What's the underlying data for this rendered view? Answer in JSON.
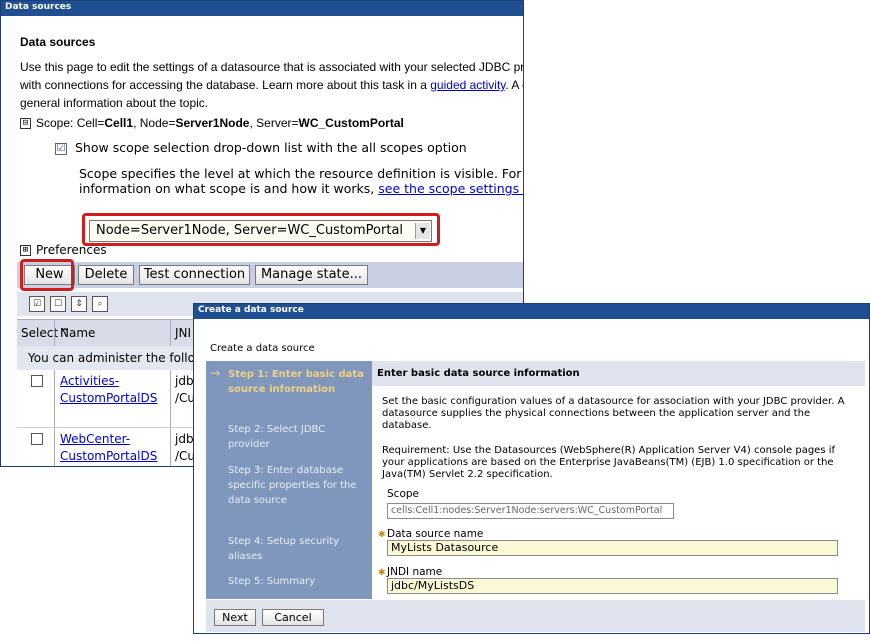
{
  "back_window": {
    "title": "Data sources",
    "heading": "Data sources",
    "desc_line1": "Use this page to edit the settings of a datasource that is associated with your selected JDBC provider. T",
    "desc_line2_pre": "with connections for accessing the database. Learn more about this task in a ",
    "desc_link": "guided activity",
    "desc_line2_post": ". A guided a",
    "desc_line3": "general information about the topic.",
    "scope": {
      "toggle": "⊟",
      "prefix": "Scope: Cell=",
      "cell": "Cell1",
      "node_label": ", Node=",
      "node": "Server1Node",
      "server_label": ", Server=",
      "server": "WC_CustomPortal"
    },
    "show_scope_label": "Show scope selection drop-down list with the all scopes option",
    "show_scope_checked": "☑",
    "scope_info_line1": "Scope specifies the level at which the resource definition is visible. For detailed",
    "scope_info_line2_pre": "information on what scope is and how it works, ",
    "scope_info_link": "see the scope settings help.",
    "scope_select_value": "Node=Server1Node, Server=WC_CustomPortal",
    "preferences_toggle": "⊞",
    "preferences_label": "Preferences",
    "buttons": {
      "new": "New",
      "delete": "Delete",
      "test": "Test connection",
      "manage": "Manage state..."
    },
    "toolbar_icons": [
      "select-all-icon",
      "deselect-all-icon",
      "expand-icon",
      "filter-icon"
    ],
    "table": {
      "col_select": "Select",
      "col_name": "Name",
      "sort_glyph": "⌃",
      "col_jndi": "JNI",
      "info": "You can administer the following",
      "rows": [
        {
          "name_line1": "Activities-",
          "name_line2": "CustomPortalDS",
          "jndi_line1": "jdb",
          "jndi_line2": "/Cu"
        },
        {
          "name_line1": "WebCenter-",
          "name_line2": "CustomPortalDS",
          "jndi_line1": "jdb",
          "jndi_line2": "/Cu"
        }
      ]
    }
  },
  "front_window": {
    "title": "Create a data source",
    "subtitle": "Create a data source",
    "steps": [
      {
        "label": "Step 1: Enter basic data source information",
        "active": true
      },
      {
        "label": "Step 2: Select JDBC provider",
        "active": false
      },
      {
        "label": "Step 3: Enter database specific properties for the data source",
        "active": false
      },
      {
        "label": "Step 4: Setup security aliases",
        "active": false
      },
      {
        "label": "Step 5: Summary",
        "active": false
      }
    ],
    "active_arrow": "→",
    "form_heading": "Enter basic data source information",
    "para1": "Set the basic configuration values of a datasource for association with your JDBC provider. A datasource supplies the physical connections between the application server and the database.",
    "para2": "Requirement: Use the Datasources (WebSphere(R) Application Server V4) console pages if your applications are based on the Enterprise JavaBeans(TM) (EJB) 1.0 specification or the Java(TM) Servlet 2.2 specification.",
    "scope_label": "Scope",
    "scope_value": "cells:Cell1:nodes:Server1Node:servers:WC_CustomPortal",
    "required_marker": "✱",
    "ds_name_label": "Data source name",
    "ds_name_value": "MyLists Datasource",
    "jndi_label": "JNDI name",
    "jndi_value": "jdbc/MyListsDS",
    "next_button": "Next",
    "cancel_button": "Cancel"
  }
}
